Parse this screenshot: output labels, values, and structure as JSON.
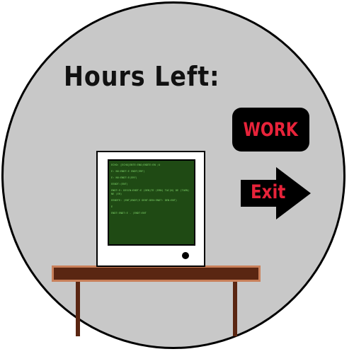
{
  "hud": {
    "hours_left_label": "Hours  Left:"
  },
  "actions": {
    "work_label": "WORK",
    "exit_label": "Exit"
  },
  "computer": {
    "screen_lines": [
      "ECHO: [ECHO]ENTE:ENO;ENDTE:EN ;U",
      "E: NU:ENDT:E ENDT(ERF)",
      "E: NU:ENDT:E(ERF)",
      "EENDT:(ENT)",
      "ENDT:E: DESCN:ENDT:E (DEN)TE (ERN) TAC(N) DE (TAEN) NE (ER)",
      "",
      "EENDTE: (ENT)ENDT(E DENT:DEN:ENDT: DEN:ENT)",
      "E",
      "",
      "ENDT:ENDT:E - (ENDT:ENT"
    ]
  },
  "colors": {
    "background_circle": "#c8c8c8",
    "button_fill": "#000000",
    "button_text": "#e8233a",
    "screen": "#1f4a14",
    "code_text": "#7fd36a",
    "desk": "#5a2612",
    "desk_edge": "#c9805a"
  }
}
